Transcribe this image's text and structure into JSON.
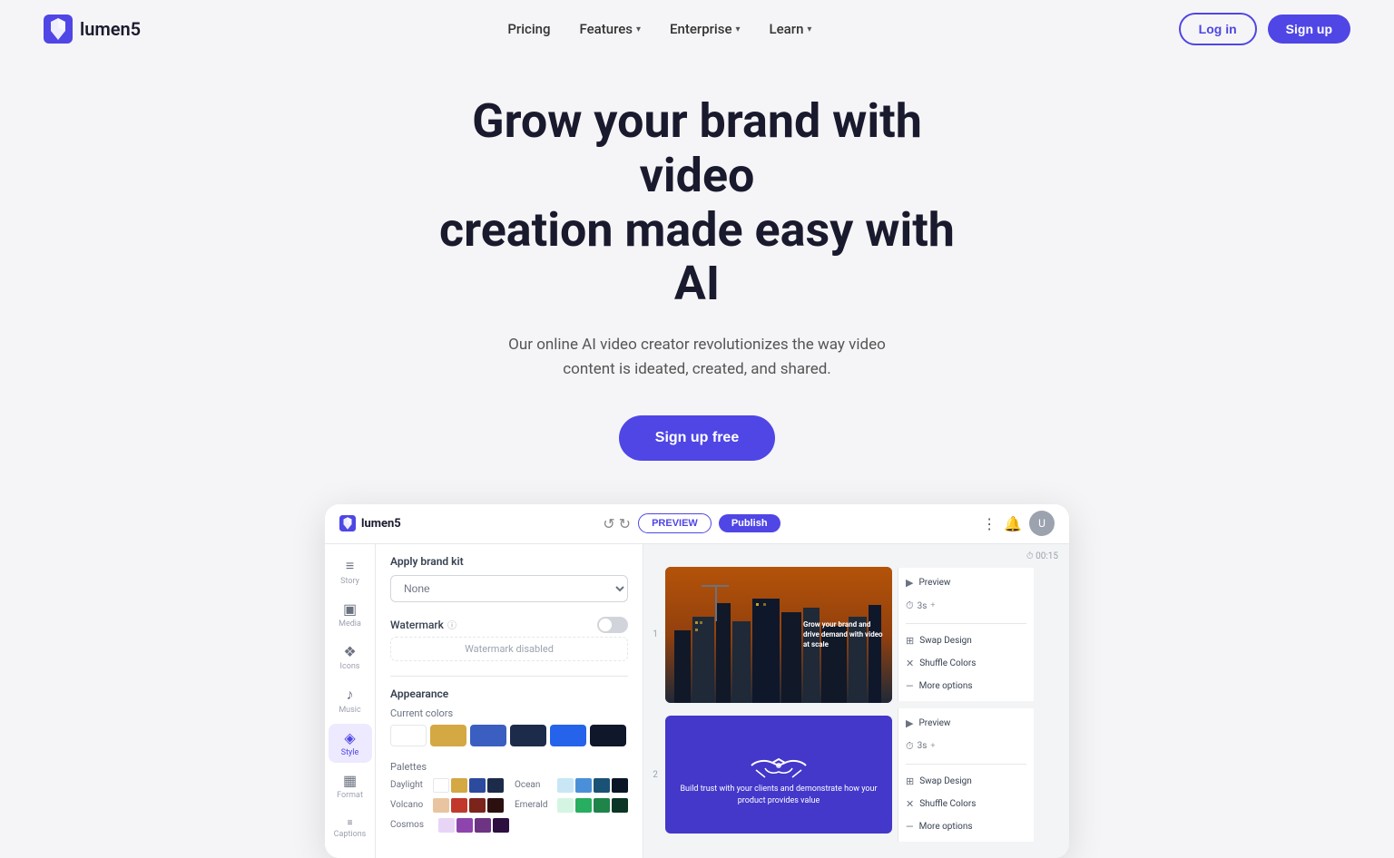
{
  "navbar": {
    "logo_text": "lumen5",
    "links": [
      {
        "label": "Pricing",
        "has_dropdown": false
      },
      {
        "label": "Features",
        "has_dropdown": true
      },
      {
        "label": "Enterprise",
        "has_dropdown": true
      },
      {
        "label": "Learn",
        "has_dropdown": true
      }
    ],
    "login_label": "Log in",
    "signup_label": "Sign up"
  },
  "hero": {
    "title_line1": "Grow your brand with video",
    "title_line2": "creation made easy with AI",
    "subtitle": "Our online AI video creator revolutionizes the way video content is ideated, created, and shared.",
    "cta_label": "Sign up free"
  },
  "app": {
    "logo_text": "lumen5",
    "topbar": {
      "preview_label": "PREVIEW",
      "publish_label": "Publish",
      "kebab_label": "⋮",
      "notif_label": "🔔",
      "timer_label": "00:15"
    },
    "sidebar_items": [
      {
        "label": "Story",
        "icon": "≡"
      },
      {
        "label": "Media",
        "icon": "▣"
      },
      {
        "label": "Icons",
        "icon": "❖"
      },
      {
        "label": "Music",
        "icon": "♪"
      },
      {
        "label": "Style",
        "icon": "◈",
        "active": true
      },
      {
        "label": "Format",
        "icon": "▦"
      },
      {
        "label": "Captions",
        "icon": "≡"
      }
    ],
    "settings": {
      "brand_kit_title": "Apply brand kit",
      "brand_kit_placeholder": "None",
      "watermark_label": "Watermark",
      "watermark_disabled_text": "Watermark disabled",
      "appearance_title": "Appearance",
      "current_colors_title": "Current colors",
      "current_colors": [
        "#ffffff",
        "#d4a843",
        "#3b5fc0",
        "#1c2b4a"
      ],
      "palettes_title": "Palettes",
      "palettes": [
        {
          "label": "Daylight",
          "colors": [
            "#ffffff",
            "#d4a843",
            "#2c4a9e",
            "#1c2b4a"
          ]
        },
        {
          "label": "Ocean",
          "colors": [
            "#c8e6f5",
            "#4a90d9",
            "#1a5276",
            "#0a1628"
          ]
        },
        {
          "label": "Volcano",
          "colors": [
            "#e8c5a0",
            "#c0392b",
            "#7b241c",
            "#2c1010"
          ]
        },
        {
          "label": "Emerald",
          "colors": [
            "#d5f5e3",
            "#27ae60",
            "#1e8449",
            "#0b3626"
          ]
        },
        {
          "label": "Cosmos",
          "colors": [
            "#e8d5f5",
            "#8e44ad",
            "#6c3483",
            "#2d1040"
          ]
        }
      ]
    },
    "slides": [
      {
        "number": "1",
        "text": "Grow your brand and drive demand with video at scale",
        "panel_items": [
          {
            "icon": "▶",
            "label": "Preview"
          },
          {
            "icon": "⏱",
            "label": "3s"
          },
          {
            "icon": "⊞",
            "label": "Swap Design"
          },
          {
            "icon": "✕",
            "label": "Shuffle Colors"
          },
          {
            "icon": "—",
            "label": "More options"
          }
        ]
      },
      {
        "number": "2",
        "text": "Build trust with your clients and demonstrate how your product provides value",
        "panel_items": [
          {
            "icon": "▶",
            "label": "Preview"
          },
          {
            "icon": "⏱",
            "label": "3s"
          },
          {
            "icon": "⊞",
            "label": "Swap Design"
          },
          {
            "icon": "✕",
            "label": "Shuffle Colors"
          },
          {
            "icon": "—",
            "label": "More options"
          }
        ]
      }
    ]
  }
}
